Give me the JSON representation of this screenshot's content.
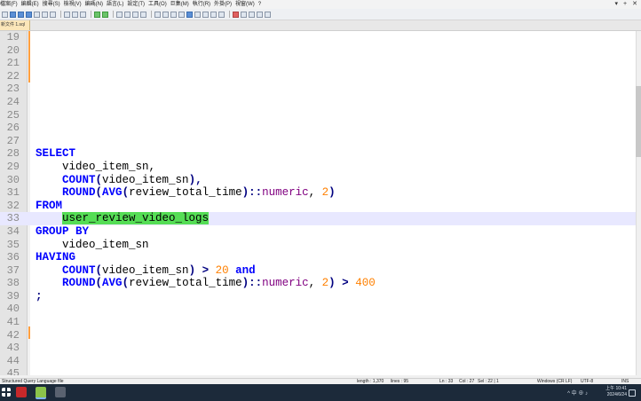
{
  "menu": [
    "檔案(F)",
    "編輯(E)",
    "搜尋(S)",
    "檢視(V)",
    "編碼(N)",
    "語言(L)",
    "設定(T)",
    "工具(O)",
    "巨集(M)",
    "執行(R)",
    "外掛(P)",
    "視窗(W)",
    "?"
  ],
  "window_controls": [
    "▾",
    "+",
    "✕"
  ],
  "tab": {
    "label": "新文件 1.sql"
  },
  "editor": {
    "lines": [
      {
        "n": "19",
        "tokens": []
      },
      {
        "n": "20",
        "tokens": []
      },
      {
        "n": "21",
        "tokens": []
      },
      {
        "n": "22",
        "tokens": []
      },
      {
        "n": "23",
        "tokens": []
      },
      {
        "n": "24",
        "tokens": []
      },
      {
        "n": "25",
        "tokens": []
      },
      {
        "n": "26",
        "tokens": []
      },
      {
        "n": "27",
        "tokens": []
      },
      {
        "n": "28",
        "tokens": [
          {
            "t": "SELECT",
            "c": "kw"
          }
        ]
      },
      {
        "n": "29",
        "tokens": [
          {
            "t": "    video_item_sn,",
            "c": "id"
          }
        ]
      },
      {
        "n": "30",
        "tokens": [
          {
            "t": "    ",
            "c": "id"
          },
          {
            "t": "COUNT",
            "c": "kw"
          },
          {
            "t": "(",
            "c": "op"
          },
          {
            "t": "video_item_sn",
            "c": "id"
          },
          {
            "t": "),",
            "c": "op"
          }
        ]
      },
      {
        "n": "31",
        "tokens": [
          {
            "t": "    ",
            "c": "id"
          },
          {
            "t": "ROUND",
            "c": "kw"
          },
          {
            "t": "(",
            "c": "op"
          },
          {
            "t": "AVG",
            "c": "kw"
          },
          {
            "t": "(",
            "c": "op"
          },
          {
            "t": "review_total_time",
            "c": "id"
          },
          {
            "t": ")::",
            "c": "op"
          },
          {
            "t": "numeric",
            "c": "fn"
          },
          {
            "t": ", ",
            "c": "id"
          },
          {
            "t": "2",
            "c": "num"
          },
          {
            "t": ")",
            "c": "op"
          }
        ]
      },
      {
        "n": "32",
        "tokens": [
          {
            "t": "FROM",
            "c": "kw"
          }
        ]
      },
      {
        "n": "33",
        "current": true,
        "tokens": [
          {
            "t": "    ",
            "c": "id"
          },
          {
            "t": "user_review_video_logs",
            "c": "hl"
          }
        ]
      },
      {
        "n": "34",
        "tokens": [
          {
            "t": "GROUP BY",
            "c": "kw"
          }
        ]
      },
      {
        "n": "35",
        "tokens": [
          {
            "t": "    video_item_sn",
            "c": "id"
          }
        ]
      },
      {
        "n": "36",
        "tokens": [
          {
            "t": "HAVING",
            "c": "kw"
          }
        ]
      },
      {
        "n": "37",
        "tokens": [
          {
            "t": "    ",
            "c": "id"
          },
          {
            "t": "COUNT",
            "c": "kw"
          },
          {
            "t": "(",
            "c": "op"
          },
          {
            "t": "video_item_sn",
            "c": "id"
          },
          {
            "t": ") > ",
            "c": "op"
          },
          {
            "t": "20",
            "c": "num"
          },
          {
            "t": " ",
            "c": "id"
          },
          {
            "t": "and",
            "c": "kw"
          }
        ]
      },
      {
        "n": "38",
        "tokens": [
          {
            "t": "    ",
            "c": "id"
          },
          {
            "t": "ROUND",
            "c": "kw"
          },
          {
            "t": "(",
            "c": "op"
          },
          {
            "t": "AVG",
            "c": "kw"
          },
          {
            "t": "(",
            "c": "op"
          },
          {
            "t": "review_total_time",
            "c": "id"
          },
          {
            "t": ")::",
            "c": "op"
          },
          {
            "t": "numeric",
            "c": "fn"
          },
          {
            "t": ", ",
            "c": "id"
          },
          {
            "t": "2",
            "c": "num"
          },
          {
            "t": ") > ",
            "c": "op"
          },
          {
            "t": "400",
            "c": "num"
          }
        ]
      },
      {
        "n": "39",
        "tokens": [
          {
            "t": ";",
            "c": "op"
          }
        ]
      },
      {
        "n": "40",
        "tokens": []
      },
      {
        "n": "41",
        "tokens": []
      },
      {
        "n": "42",
        "tokens": []
      },
      {
        "n": "43",
        "tokens": []
      },
      {
        "n": "44",
        "tokens": []
      },
      {
        "n": "45",
        "tokens": []
      }
    ]
  },
  "status": {
    "file_type": "Structured Query Language file",
    "length": "length : 1,370",
    "lines": "lines : 95",
    "ln": "Ln : 33",
    "col": "Col : 27",
    "sel": "Sel : 22 | 1",
    "eol": "Windows (CR LF)",
    "encoding": "UTF-8",
    "mode": "INS"
  },
  "taskbar": {
    "time": "上午 10:41",
    "date": "2024/6/24",
    "tray_text": "^ 中 ⊕ ♪"
  },
  "colors": {
    "keyword": "#0000ff",
    "number": "#ff8000",
    "type": "#800080",
    "highlight": "#55dd55",
    "current_line": "#e8e8ff"
  }
}
